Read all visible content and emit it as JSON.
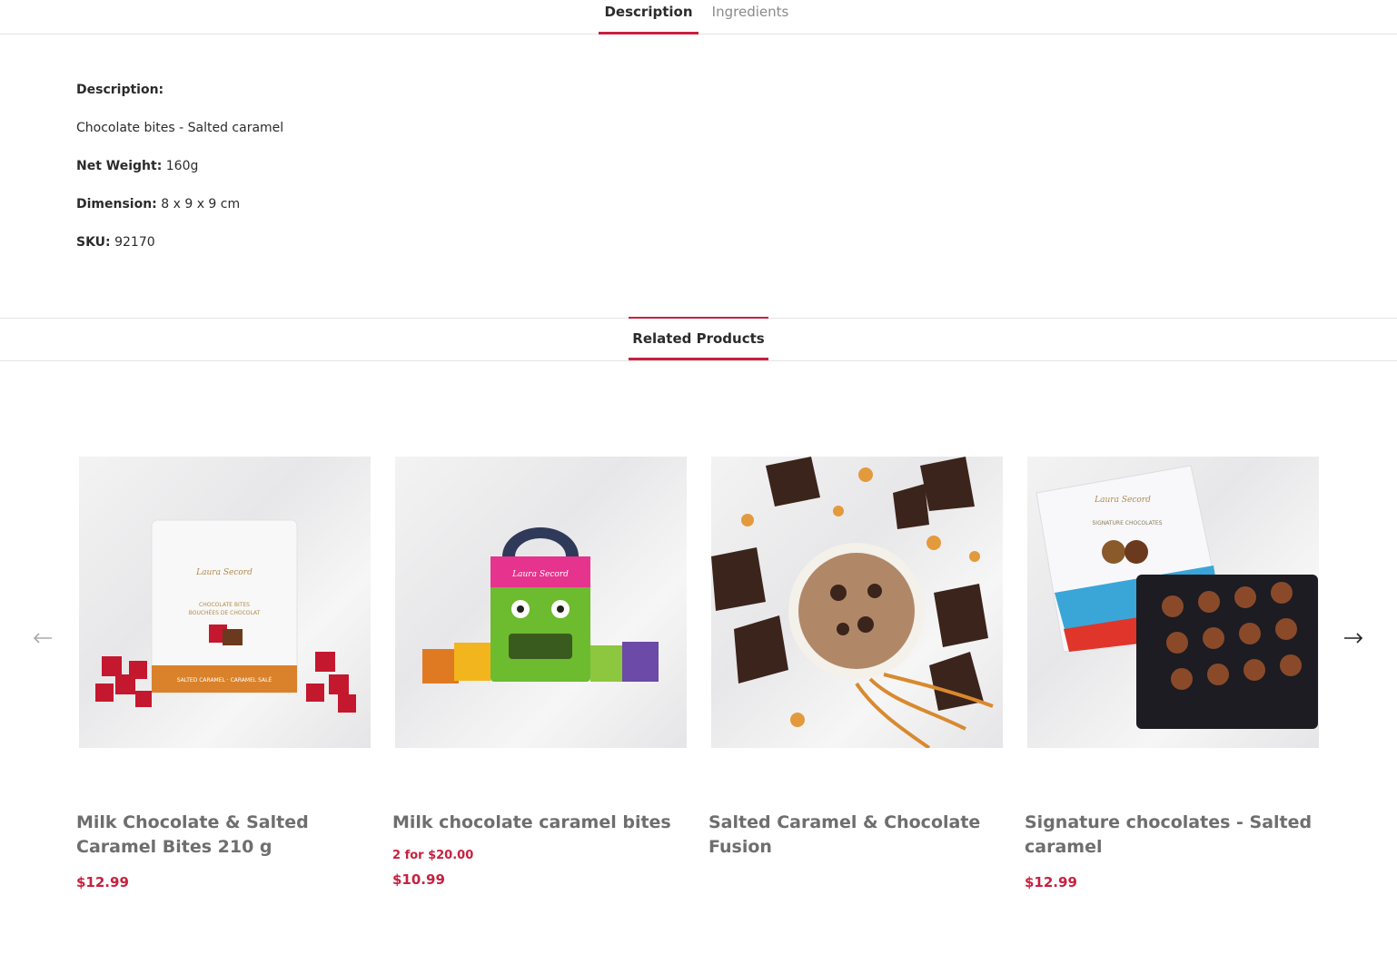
{
  "tabs": {
    "description": "Description",
    "ingredients": "Ingredients"
  },
  "description": {
    "heading": "Description:",
    "text": "Chocolate bites - Salted caramel",
    "net_weight_label": "Net Weight:",
    "net_weight_value": "160g",
    "dimension_label": "Dimension:",
    "dimension_value": "8 x 9 x 9 cm",
    "sku_label": "SKU:",
    "sku_value": "92170"
  },
  "related": {
    "title": "Related Products",
    "products": [
      {
        "name": "Milk Chocolate & Salted Caramel Bites 210 g",
        "promo": "",
        "price": "$12.99"
      },
      {
        "name": "Milk chocolate caramel bites",
        "promo": "2 for $20.00",
        "price": "$10.99"
      },
      {
        "name": "Salted Caramel & Chocolate Fusion",
        "promo": "",
        "price": ""
      },
      {
        "name": "Signature chocolates - Salted caramel",
        "promo": "",
        "price": "$12.99"
      }
    ]
  },
  "colors": {
    "accent": "#c8203f",
    "text": "#2b2b2b",
    "muted": "#8a8a8a"
  },
  "icons": {
    "prev": "arrow-left-icon",
    "next": "arrow-right-icon"
  }
}
